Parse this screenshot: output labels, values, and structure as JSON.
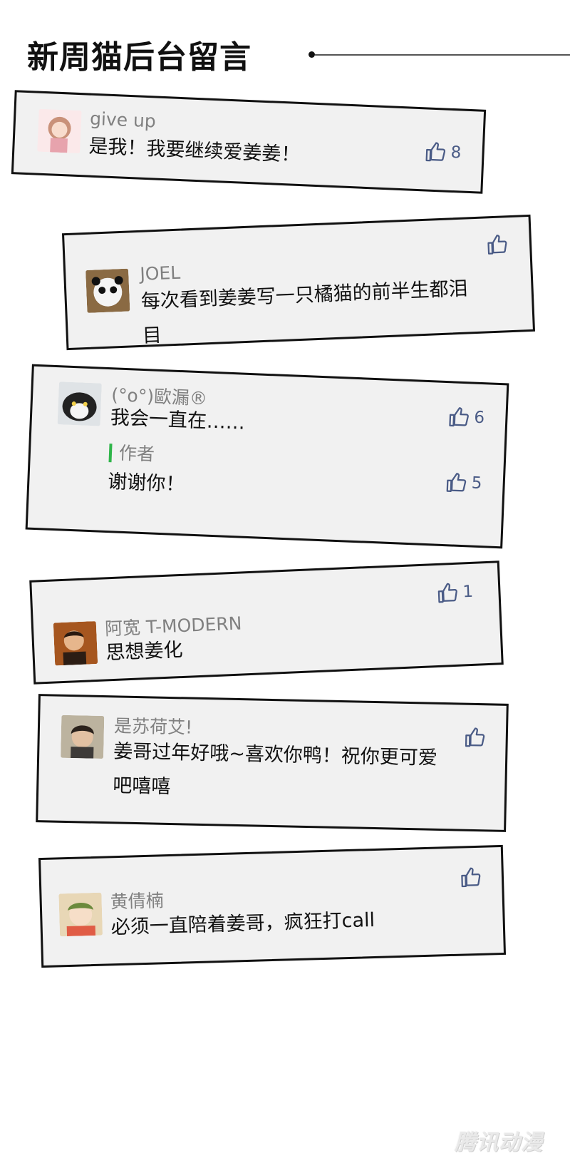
{
  "header": {
    "title": "新周猫后台留言"
  },
  "comments": [
    {
      "user": "give up",
      "text": "是我！我要继续爱姜姜！",
      "likes": "8",
      "avatar_icon": "girl-avatar-icon"
    },
    {
      "user": "JOEL",
      "text_lines": [
        "每次看到姜姜写一只橘猫的前半生都泪",
        "目"
      ],
      "likes": "",
      "avatar_icon": "panda-avatar-icon"
    },
    {
      "user": "(°o°)歐漏®",
      "text": "我会一直在……",
      "likes": "6",
      "author_label": "作者",
      "reply": "谢谢你！",
      "reply_likes": "5",
      "avatar_icon": "cat-avatar-icon"
    },
    {
      "user": "阿宽 T-MODERN",
      "text": "思想姜化",
      "likes": "1",
      "avatar_icon": "man-avatar-icon"
    },
    {
      "user": "是苏荷艾!",
      "text_lines": [
        "姜哥过年好哦~喜欢你鸭！祝你更可爱",
        "吧嘻嘻"
      ],
      "likes": "",
      "avatar_icon": "boy-avatar-icon"
    },
    {
      "user": "黄倩楠",
      "text": "必须一直陪着姜哥，疯狂打call",
      "likes": "",
      "avatar_icon": "cartoon-avatar-icon"
    }
  ],
  "footer": {
    "watermark": "腾讯动漫"
  },
  "colors": {
    "like_icon": "#4a5b86",
    "author_bar": "#2fb54a",
    "card_bg": "#f1f1f1"
  }
}
